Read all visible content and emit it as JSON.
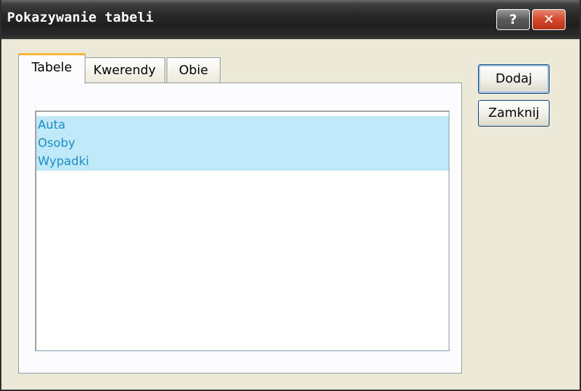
{
  "window": {
    "title": "Pokazywanie tabeli",
    "help_label": "?",
    "close_label": "✕"
  },
  "tabs": [
    {
      "label": "Tabele",
      "active": true
    },
    {
      "label": "Kwerendy",
      "active": false
    },
    {
      "label": "Obie",
      "active": false
    }
  ],
  "list": {
    "items": [
      "Auta",
      "Osoby",
      "Wypadki"
    ],
    "selected": [
      "Auta",
      "Osoby",
      "Wypadki"
    ]
  },
  "buttons": {
    "add_label": "Dodaj",
    "close_label": "Zamknij"
  },
  "colors": {
    "selection_bg": "#bfe8f8",
    "selection_text": "#1a8ec8",
    "active_tab_accent": "#f5b431",
    "close_button": "#d4472b"
  }
}
